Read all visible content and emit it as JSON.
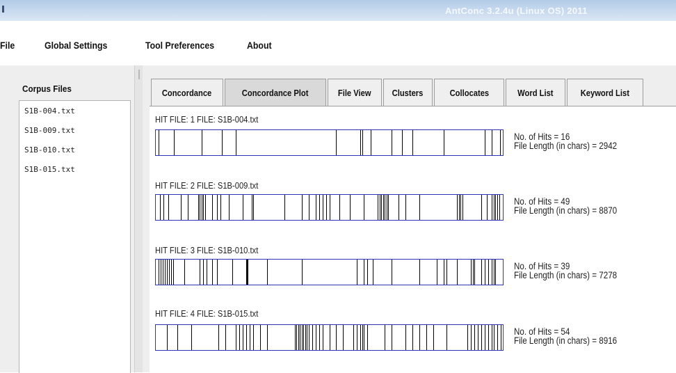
{
  "window": {
    "title": "AntConc 3.2.4u (Linux OS) 2011"
  },
  "menu": {
    "file": "File",
    "global_settings": "Global Settings",
    "tool_preferences": "Tool Preferences",
    "about": "About"
  },
  "corpus": {
    "title": "Corpus Files",
    "files": [
      "S1B-004.txt",
      "S1B-009.txt",
      "S1B-010.txt",
      "S1B-015.txt"
    ]
  },
  "tabs": [
    "Concordance",
    "Concordance Plot",
    "File View",
    "Clusters",
    "Collocates",
    "Word List",
    "Keyword List"
  ],
  "active_tab": "Concordance Plot",
  "plots": [
    {
      "heading": "HIT FILE: 1   FILE: S1B-004.txt",
      "hits_label": "No. of Hits = 16",
      "length_label": "File Length (in chars) = 2942",
      "hits": 16,
      "file_length": 2942,
      "marks": [
        0.006,
        0.05,
        0.13,
        0.19,
        0.23,
        0.52,
        0.59,
        0.595,
        0.62,
        0.68,
        0.71,
        0.74,
        0.83,
        0.95,
        0.97,
        0.994
      ]
    },
    {
      "heading": "HIT FILE: 2   FILE: S1B-009.txt",
      "hits_label": "No. of Hits = 49",
      "length_label": "File Length (in chars) = 8870",
      "hits": 49,
      "file_length": 8870,
      "marks": [
        0.01,
        0.02,
        0.035,
        0.07,
        0.09,
        0.12,
        0.125,
        0.13,
        0.135,
        0.14,
        0.16,
        0.175,
        0.185,
        0.21,
        0.25,
        0.275,
        0.28,
        0.37,
        0.42,
        0.44,
        0.46,
        0.47,
        0.48,
        0.49,
        0.5,
        0.53,
        0.56,
        0.6,
        0.64,
        0.645,
        0.65,
        0.655,
        0.66,
        0.665,
        0.67,
        0.7,
        0.72,
        0.76,
        0.87,
        0.875,
        0.88,
        0.885,
        0.94,
        0.955,
        0.97,
        0.975,
        0.98,
        0.985,
        0.992
      ]
    },
    {
      "heading": "HIT FILE: 3   FILE: S1B-010.txt",
      "hits_label": "No. of Hits = 39",
      "length_label": "File Length (in chars) = 7278",
      "hits": 39,
      "file_length": 7278,
      "marks": [
        0.006,
        0.012,
        0.018,
        0.024,
        0.03,
        0.036,
        0.042,
        0.048,
        0.08,
        0.125,
        0.135,
        0.145,
        0.16,
        0.175,
        0.22,
        0.26,
        0.262,
        0.264,
        0.32,
        0.42,
        0.58,
        0.6,
        0.61,
        0.625,
        0.68,
        0.76,
        0.81,
        0.83,
        0.84,
        0.87,
        0.91,
        0.915,
        0.92,
        0.94,
        0.95,
        0.96,
        0.97,
        0.975,
        0.98
      ]
    },
    {
      "heading": "HIT FILE: 4   FILE: S1B-015.txt",
      "hits_label": "No. of Hits = 54",
      "length_label": "File Length (in chars) = 8916",
      "hits": 54,
      "file_length": 8916,
      "marks": [
        0.03,
        0.06,
        0.1,
        0.18,
        0.2,
        0.23,
        0.24,
        0.25,
        0.26,
        0.27,
        0.28,
        0.3,
        0.32,
        0.4,
        0.405,
        0.41,
        0.415,
        0.42,
        0.425,
        0.43,
        0.435,
        0.44,
        0.45,
        0.46,
        0.47,
        0.48,
        0.5,
        0.52,
        0.54,
        0.57,
        0.58,
        0.59,
        0.595,
        0.6,
        0.61,
        0.66,
        0.68,
        0.72,
        0.74,
        0.76,
        0.78,
        0.8,
        0.84,
        0.9,
        0.91,
        0.92,
        0.93,
        0.94,
        0.95,
        0.96,
        0.97,
        0.975,
        0.985,
        0.995
      ]
    }
  ],
  "colors": {
    "plot_border": "#2f33b8",
    "hit_mark": "#000000"
  }
}
